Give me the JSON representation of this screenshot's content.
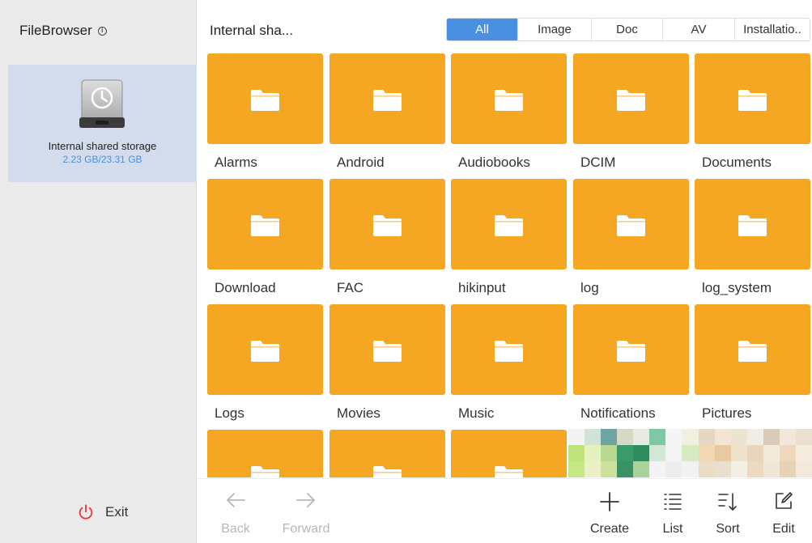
{
  "sidebar": {
    "app_title": "FileBrowser",
    "info_icon": "info-icon",
    "storage": {
      "name": "Internal shared storage",
      "size": "2.23 GB/23.31 GB",
      "icon": "hard-drive-icon"
    },
    "exit_label": "Exit",
    "exit_icon": "power-icon",
    "colors": {
      "selected_bg": "#d3dcec",
      "size_text": "#4a8fdf",
      "power": "#e53935"
    }
  },
  "header": {
    "path": "Internal sha...",
    "tabs": [
      {
        "label": "All",
        "active": true
      },
      {
        "label": "Image",
        "active": false
      },
      {
        "label": "Doc",
        "active": false
      },
      {
        "label": "AV",
        "active": false
      },
      {
        "label": "Installatio..",
        "active": false
      }
    ],
    "active_color": "#4a90e2"
  },
  "folders": [
    {
      "label": "Alarms"
    },
    {
      "label": "Android"
    },
    {
      "label": "Audiobooks"
    },
    {
      "label": "DCIM"
    },
    {
      "label": "Documents"
    },
    {
      "label": "Download"
    },
    {
      "label": "FAC"
    },
    {
      "label": "hikinput"
    },
    {
      "label": "log"
    },
    {
      "label": "log_system"
    },
    {
      "label": "Logs"
    },
    {
      "label": "Movies"
    },
    {
      "label": "Music"
    },
    {
      "label": "Notifications"
    },
    {
      "label": "Pictures"
    },
    {
      "label": ""
    },
    {
      "label": ""
    },
    {
      "label": ""
    }
  ],
  "folder_color": "#f5a623",
  "toolbar": {
    "back": {
      "label": "Back",
      "icon": "arrow-left-icon",
      "enabled": false
    },
    "forward": {
      "label": "Forward",
      "icon": "arrow-right-icon",
      "enabled": false
    },
    "create": {
      "label": "Create",
      "icon": "plus-icon",
      "enabled": true
    },
    "list": {
      "label": "List",
      "icon": "list-icon",
      "enabled": true
    },
    "sort": {
      "label": "Sort",
      "icon": "sort-icon",
      "enabled": true
    },
    "edit": {
      "label": "Edit",
      "icon": "edit-icon",
      "enabled": true
    }
  }
}
